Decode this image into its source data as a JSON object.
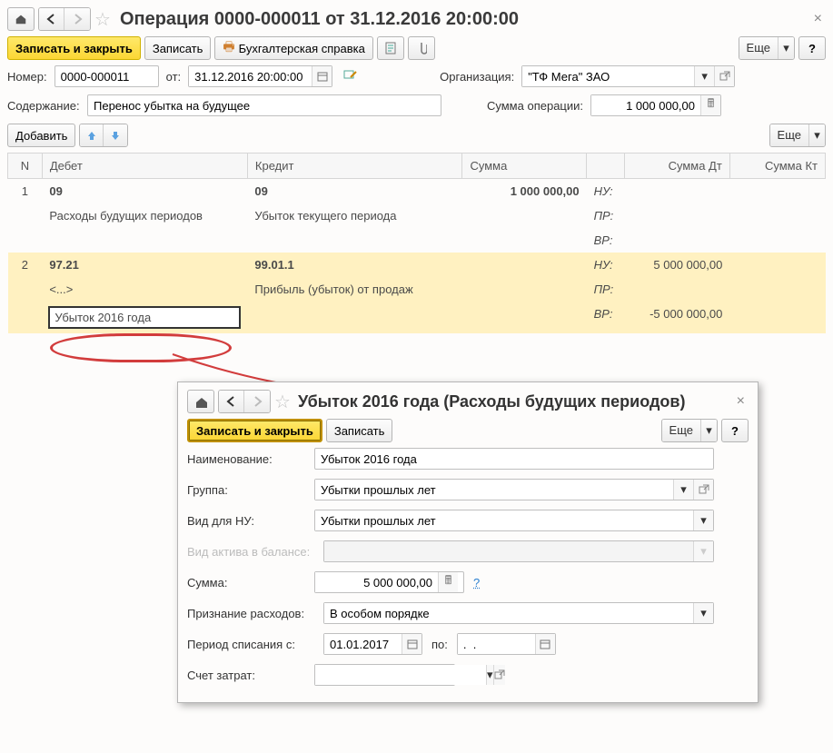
{
  "header": {
    "title": "Операция 0000-000011 от 31.12.2016 20:00:00"
  },
  "toolbar": {
    "save_close": "Записать и закрыть",
    "save": "Записать",
    "accounting_ref": "Бухгалтерская справка",
    "more": "Еще"
  },
  "fields": {
    "number_label": "Номер:",
    "number_value": "0000-000011",
    "from_label": "от:",
    "date_value": "31.12.2016 20:00:00",
    "org_label": "Организация:",
    "org_value": "\"ТФ Мега\" ЗАО",
    "content_label": "Содержание:",
    "content_value": "Перенос убытка на будущее",
    "op_sum_label": "Сумма операции:",
    "op_sum_value": "1 000 000,00"
  },
  "table_toolbar": {
    "add": "Добавить",
    "more": "Еще"
  },
  "grid": {
    "headers": {
      "n": "N",
      "debit": "Дебет",
      "credit": "Кредит",
      "sum": "Сумма",
      "sum_dt": "Сумма Дт",
      "sum_kt": "Сумма Кт"
    },
    "tax_labels": {
      "nu": "НУ:",
      "pr": "ПР:",
      "vr": "ВР:"
    },
    "rows": [
      {
        "n": "1",
        "debit_acc": "09",
        "debit_sub": "Расходы будущих периодов",
        "credit_acc": "09",
        "credit_sub": "Убыток текущего периода",
        "sum": "1 000 000,00",
        "dt_nu": "",
        "dt_pr": "",
        "dt_vr": "",
        "kt_nu": "",
        "kt_pr": "",
        "kt_vr": ""
      },
      {
        "n": "2",
        "debit_acc": "97.21",
        "debit_sub1": "<...>",
        "debit_sub2": "Убыток 2016 года",
        "credit_acc": "99.01.1",
        "credit_sub": "Прибыль (убыток) от продаж",
        "sum": "",
        "dt_nu": "5 000 000,00",
        "dt_pr": "",
        "dt_vr": "-5 000 000,00",
        "kt_nu": "",
        "kt_pr": "",
        "kt_vr": ""
      }
    ]
  },
  "popup": {
    "title": "Убыток 2016 года (Расходы будущих периодов)",
    "save_close": "Записать и закрыть",
    "save": "Записать",
    "more": "Еще",
    "fields": {
      "name_label": "Наименование:",
      "name_value": "Убыток 2016 года",
      "group_label": "Группа:",
      "group_value": "Убытки прошлых лет",
      "nu_kind_label": "Вид для НУ:",
      "nu_kind_value": "Убытки прошлых лет",
      "asset_label": "Вид актива в балансе:",
      "sum_label": "Сумма:",
      "sum_value": "5 000 000,00",
      "recognition_label": "Признание расходов:",
      "recognition_value": "В особом порядке",
      "period_label": "Период списания с:",
      "date_from": "01.01.2017",
      "period_to_label": "по:",
      "date_to": ".  .",
      "account_label": "Счет затрат:"
    }
  }
}
